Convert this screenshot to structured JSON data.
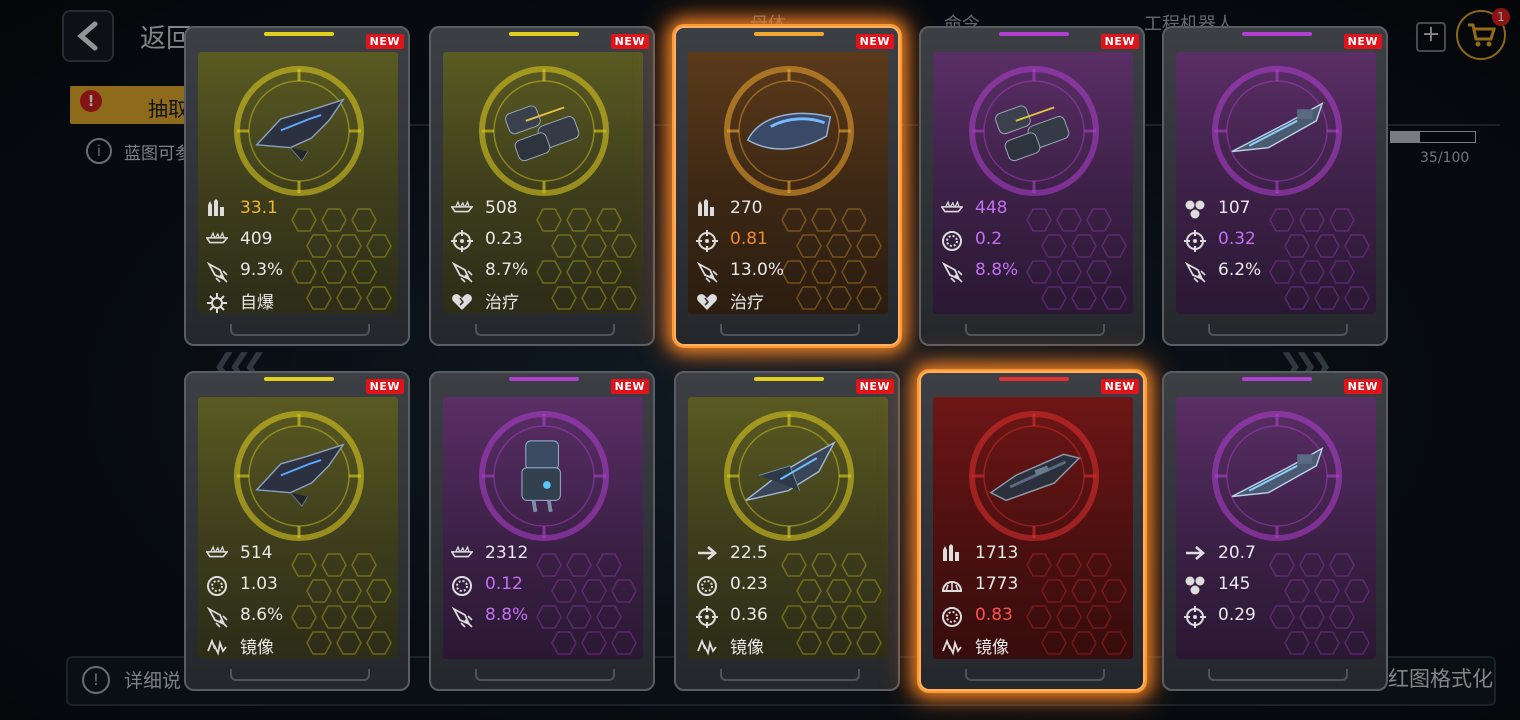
{
  "background": {
    "back_label": "返回",
    "nav": [
      "母体",
      "命令",
      "工程机器人"
    ],
    "cart_badge": "1",
    "tab_label": "抽取",
    "info_text": "蓝图可参",
    "progress": {
      "text": "35/100",
      "value": 0.35
    },
    "bottom_text": "详细说",
    "bottom_right": "红图格式化"
  },
  "cards": [
    {
      "rarity": "yellow",
      "new": "NEW",
      "ship": "fighter",
      "stats": [
        {
          "icon": "ammo",
          "value": "33.1",
          "color": "#f0b92a"
        },
        {
          "icon": "hull",
          "value": "409",
          "color": "#e8e8e8"
        },
        {
          "icon": "missile",
          "value": "9.3%",
          "color": "#e8e8e8"
        },
        {
          "icon": "explode",
          "value": "自爆",
          "color": "#e8e8e8"
        }
      ]
    },
    {
      "rarity": "yellow",
      "new": "NEW",
      "ship": "carrier",
      "stats": [
        {
          "icon": "hull",
          "value": "508",
          "color": "#e8e8e8"
        },
        {
          "icon": "crosshair",
          "value": "0.23",
          "color": "#e8e8e8"
        },
        {
          "icon": "missile",
          "value": "8.7%",
          "color": "#e8e8e8"
        },
        {
          "icon": "heal",
          "value": "治疗",
          "color": "#e8e8e8"
        }
      ]
    },
    {
      "rarity": "orange",
      "new": "NEW",
      "ship": "pod",
      "selected": true,
      "stats": [
        {
          "icon": "ammo",
          "value": "270",
          "color": "#e8e8e8"
        },
        {
          "icon": "crosshair",
          "value": "0.81",
          "color": "#f08a2a"
        },
        {
          "icon": "missile",
          "value": "13.0%",
          "color": "#e8e8e8"
        },
        {
          "icon": "heal",
          "value": "治疗",
          "color": "#e8e8e8"
        }
      ]
    },
    {
      "rarity": "purple",
      "new": "NEW",
      "ship": "carrier",
      "stats": [
        {
          "icon": "hull",
          "value": "448",
          "color": "#c070f0"
        },
        {
          "icon": "shield",
          "value": "0.2",
          "color": "#c070f0"
        },
        {
          "icon": "missile",
          "value": "8.8%",
          "color": "#c070f0"
        }
      ]
    },
    {
      "rarity": "purple",
      "new": "NEW",
      "ship": "corvette",
      "stats": [
        {
          "icon": "cluster",
          "value": "107",
          "color": "#e8e8e8"
        },
        {
          "icon": "crosshair",
          "value": "0.32",
          "color": "#c070f0"
        },
        {
          "icon": "missile",
          "value": "6.2%",
          "color": "#e8e8e8"
        }
      ]
    },
    {
      "rarity": "yellow",
      "new": "NEW",
      "ship": "fighter",
      "stats": [
        {
          "icon": "hull",
          "value": "514",
          "color": "#e8e8e8"
        },
        {
          "icon": "shield",
          "value": "1.03",
          "color": "#e8e8e8"
        },
        {
          "icon": "missile",
          "value": "8.6%",
          "color": "#e8e8e8"
        },
        {
          "icon": "mirror",
          "value": "镜像",
          "color": "#e8e8e8"
        }
      ]
    },
    {
      "rarity": "purple",
      "new": "NEW",
      "ship": "mech",
      "stats": [
        {
          "icon": "hull",
          "value": "2312",
          "color": "#e8e8e8"
        },
        {
          "icon": "shield",
          "value": "0.12",
          "color": "#c070f0"
        },
        {
          "icon": "missile",
          "value": "8.8%",
          "color": "#c070f0"
        }
      ]
    },
    {
      "rarity": "yellow",
      "new": "NEW",
      "ship": "interceptor",
      "stats": [
        {
          "icon": "speed",
          "value": "22.5",
          "color": "#e8e8e8"
        },
        {
          "icon": "shield",
          "value": "0.23",
          "color": "#e8e8e8"
        },
        {
          "icon": "crosshair",
          "value": "0.36",
          "color": "#e8e8e8"
        },
        {
          "icon": "mirror",
          "value": "镜像",
          "color": "#e8e8e8"
        }
      ]
    },
    {
      "rarity": "red",
      "new": "NEW",
      "ship": "frigate",
      "selected": true,
      "stats": [
        {
          "icon": "ammo",
          "value": "1713",
          "color": "#e8e8e8"
        },
        {
          "icon": "armor",
          "value": "1773",
          "color": "#e8e8e8"
        },
        {
          "icon": "shield",
          "value": "0.83",
          "color": "#ff5050"
        },
        {
          "icon": "mirror",
          "value": "镜像",
          "color": "#e8e8e8"
        }
      ]
    },
    {
      "rarity": "purple",
      "new": "NEW",
      "ship": "corvette",
      "stats": [
        {
          "icon": "speed",
          "value": "20.7",
          "color": "#e8e8e8"
        },
        {
          "icon": "cluster",
          "value": "145",
          "color": "#e8e8e8"
        },
        {
          "icon": "crosshair",
          "value": "0.29",
          "color": "#e8e8e8"
        }
      ]
    }
  ],
  "colors": {
    "yellow": "#e2d020",
    "orange": "#f0a830",
    "purple": "#b040d0",
    "red": "#e03030"
  }
}
